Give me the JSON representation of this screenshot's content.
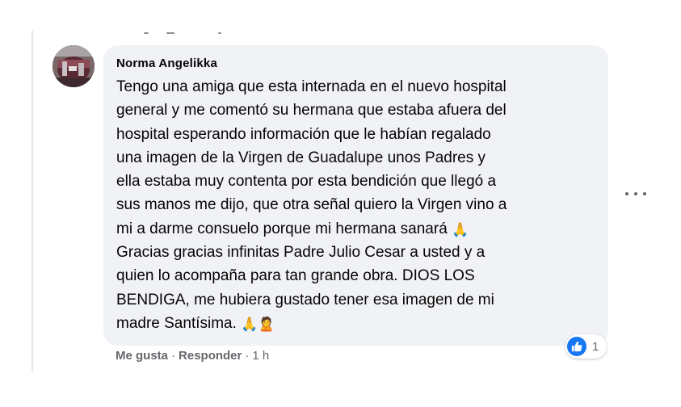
{
  "comment": {
    "author": "Norma Angelikka",
    "lines": [
      "Tengo una amiga que esta internada en el nuevo hospital",
      "general y me comentó su hermana que estaba afuera del",
      "hospital esperando información que le habían regalado",
      "una imagen de la Virgen de Guadalupe unos Padres y",
      "ella estaba muy contenta por esta bendición que llegó a",
      "sus manos me dijo, que otra señal quiero la Virgen vino a",
      "mi a darme consuelo porque mi hermana sanará",
      "Gracias gracias infinitas Padre Julio Cesar a usted y a",
      "quien lo acompaña para tan grande obra. DIOS LOS",
      "BENDIGA, me hubiera gustado tener esa imagen de mi",
      "madre Santísima."
    ],
    "emojis": {
      "praying": "🙏",
      "person": "🙎"
    },
    "reaction": {
      "icon": "like-icon",
      "count": "1",
      "color": "#1877f2"
    }
  },
  "actions": {
    "like": "Me gusta",
    "separator": "·",
    "reply": "Responder",
    "time": "1 h"
  },
  "colors": {
    "bubble": "#f0f2f5",
    "secondary_text": "#65676b",
    "primary_text": "#050505"
  }
}
